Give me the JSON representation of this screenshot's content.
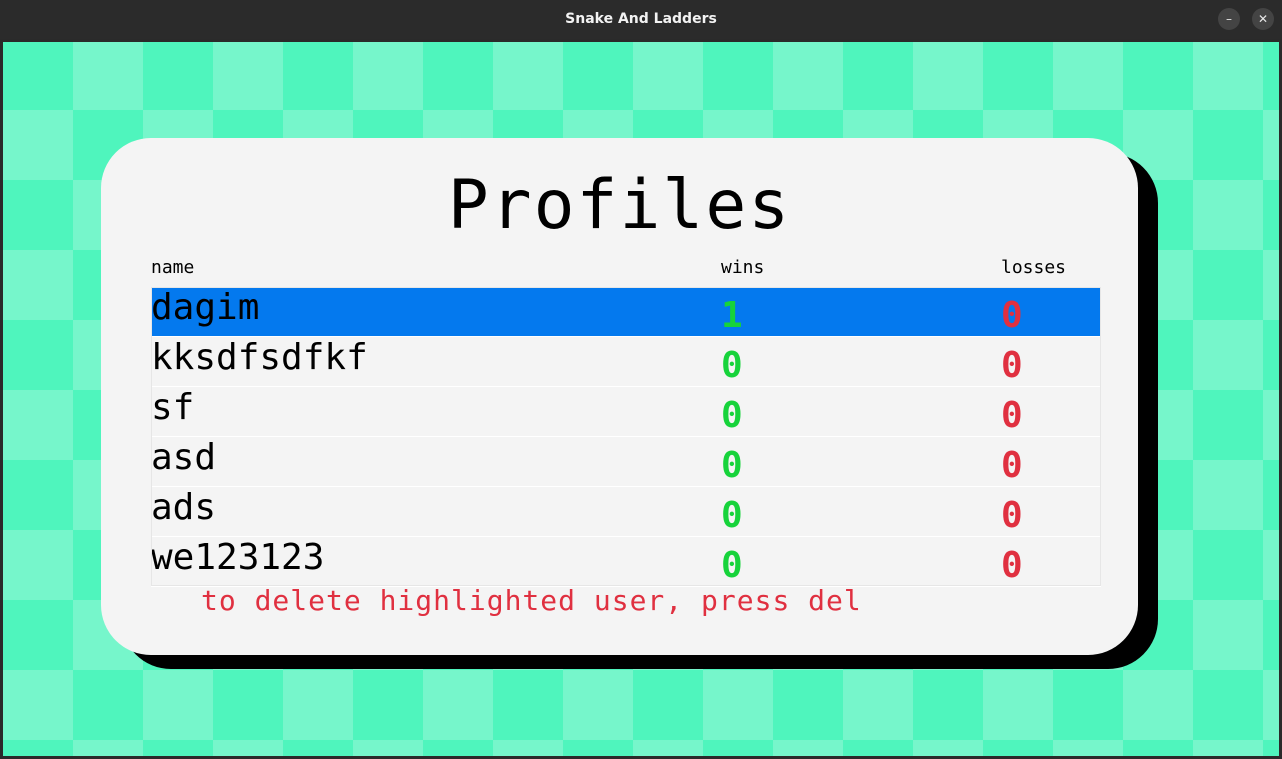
{
  "window": {
    "title": "Snake And Ladders",
    "minimize_glyph": "–",
    "close_glyph": "✕"
  },
  "profiles": {
    "title": "Profiles",
    "columns": {
      "name": "name",
      "wins": "wins",
      "losses": "losses"
    },
    "rows": [
      {
        "name": "dagim",
        "wins": "1",
        "losses": "0",
        "selected": true
      },
      {
        "name": "kksdfsdfkf",
        "wins": "0",
        "losses": "0",
        "selected": false
      },
      {
        "name": "sf",
        "wins": "0",
        "losses": "0",
        "selected": false
      },
      {
        "name": "asd",
        "wins": "0",
        "losses": "0",
        "selected": false
      },
      {
        "name": "ads",
        "wins": "0",
        "losses": "0",
        "selected": false
      },
      {
        "name": "we123123",
        "wins": "0",
        "losses": "0",
        "selected": false
      }
    ],
    "hint": "to delete highlighted user, press del"
  },
  "colors": {
    "selected_row": "#0479ee",
    "wins": "#17d33b",
    "losses": "#e03040",
    "checker_dark": "#4ff5bd",
    "checker_light": "#76f6cb",
    "card": "#f4f4f4"
  }
}
